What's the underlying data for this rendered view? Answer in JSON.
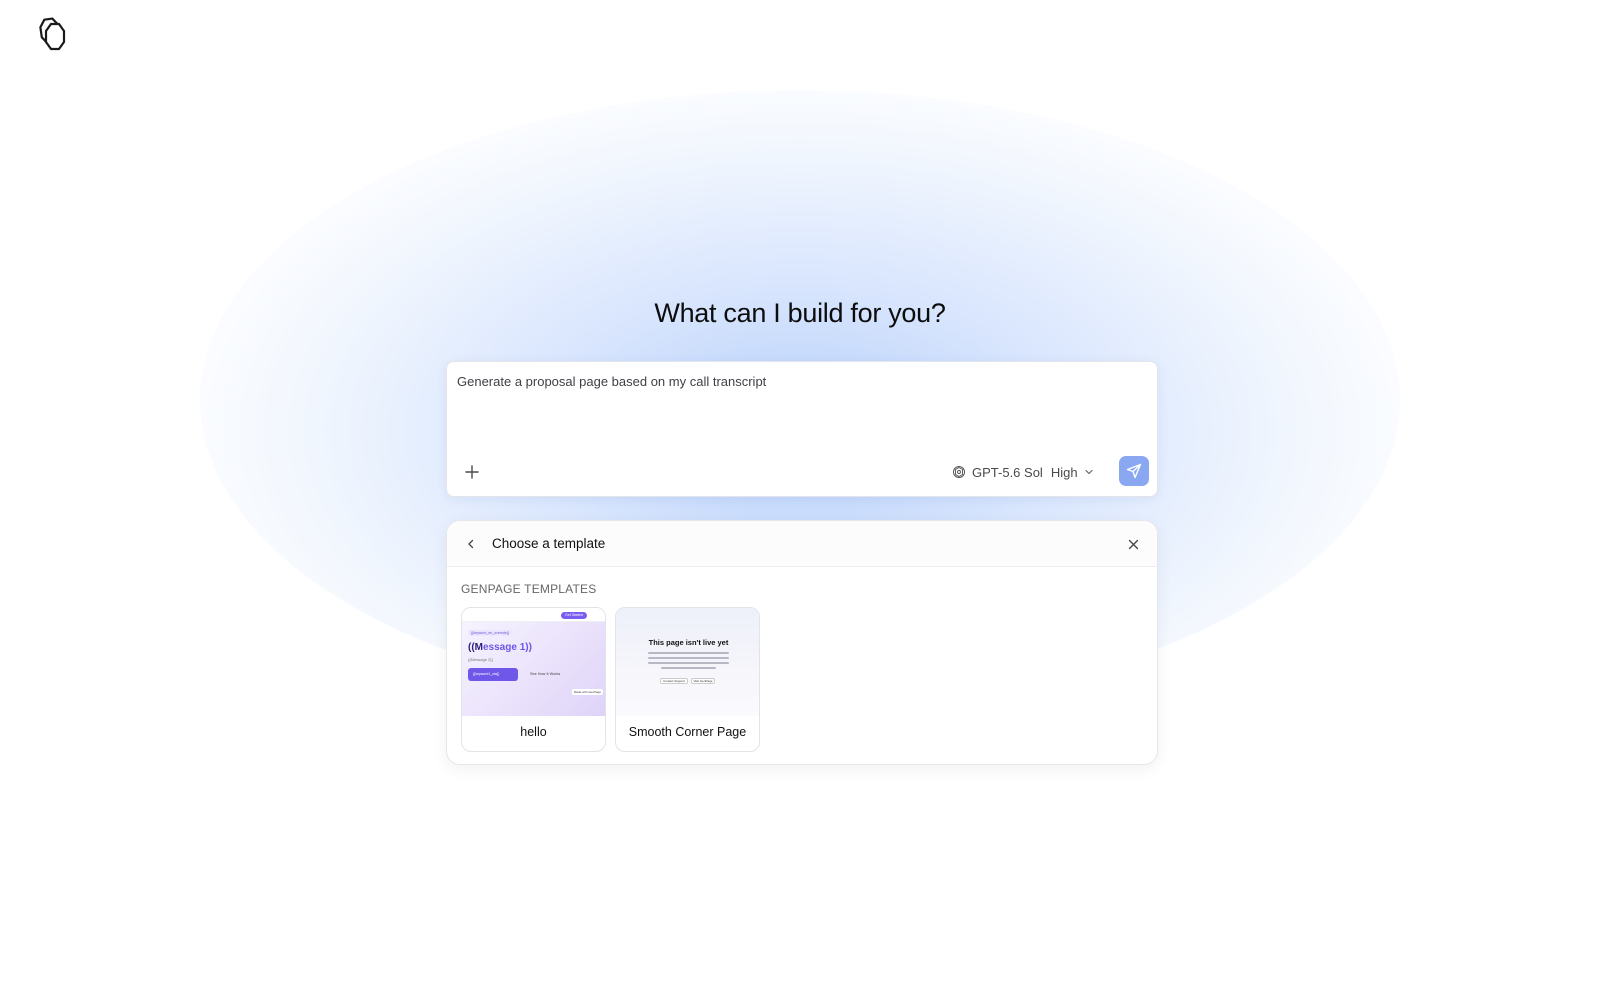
{
  "app": {
    "logo_icon": "hexagons-logo-icon"
  },
  "main": {
    "title": "What can I build for you?"
  },
  "prompt": {
    "placeholder": "Generate a proposal page based on my call transcript",
    "add_icon": "plus-icon",
    "model_icon": "openai-icon",
    "model_name": "GPT-5.6 Sol",
    "effort": "High",
    "send_icon": "send-icon",
    "send_color": "#8aa7f2"
  },
  "template_panel": {
    "title": "Choose a template",
    "section_label": "GENPAGE TEMPLATES",
    "templates": [
      {
        "label": "hello",
        "thumb": {
          "pill": "Get Started",
          "tag": "{{keyword_en_override}}",
          "heading_prefix": "((M",
          "heading_rest": "essage 1))",
          "sub": "{{Message 2}}",
          "button": "{{keyword1_cta}}",
          "link": "See How It Works",
          "badge": "Made with GenPage"
        }
      },
      {
        "label": "Smooth Corner Page",
        "thumb": {
          "heading": "This page isn't live yet",
          "btn1": "Contact Support",
          "btn2": "Visit GenPage"
        }
      }
    ]
  }
}
